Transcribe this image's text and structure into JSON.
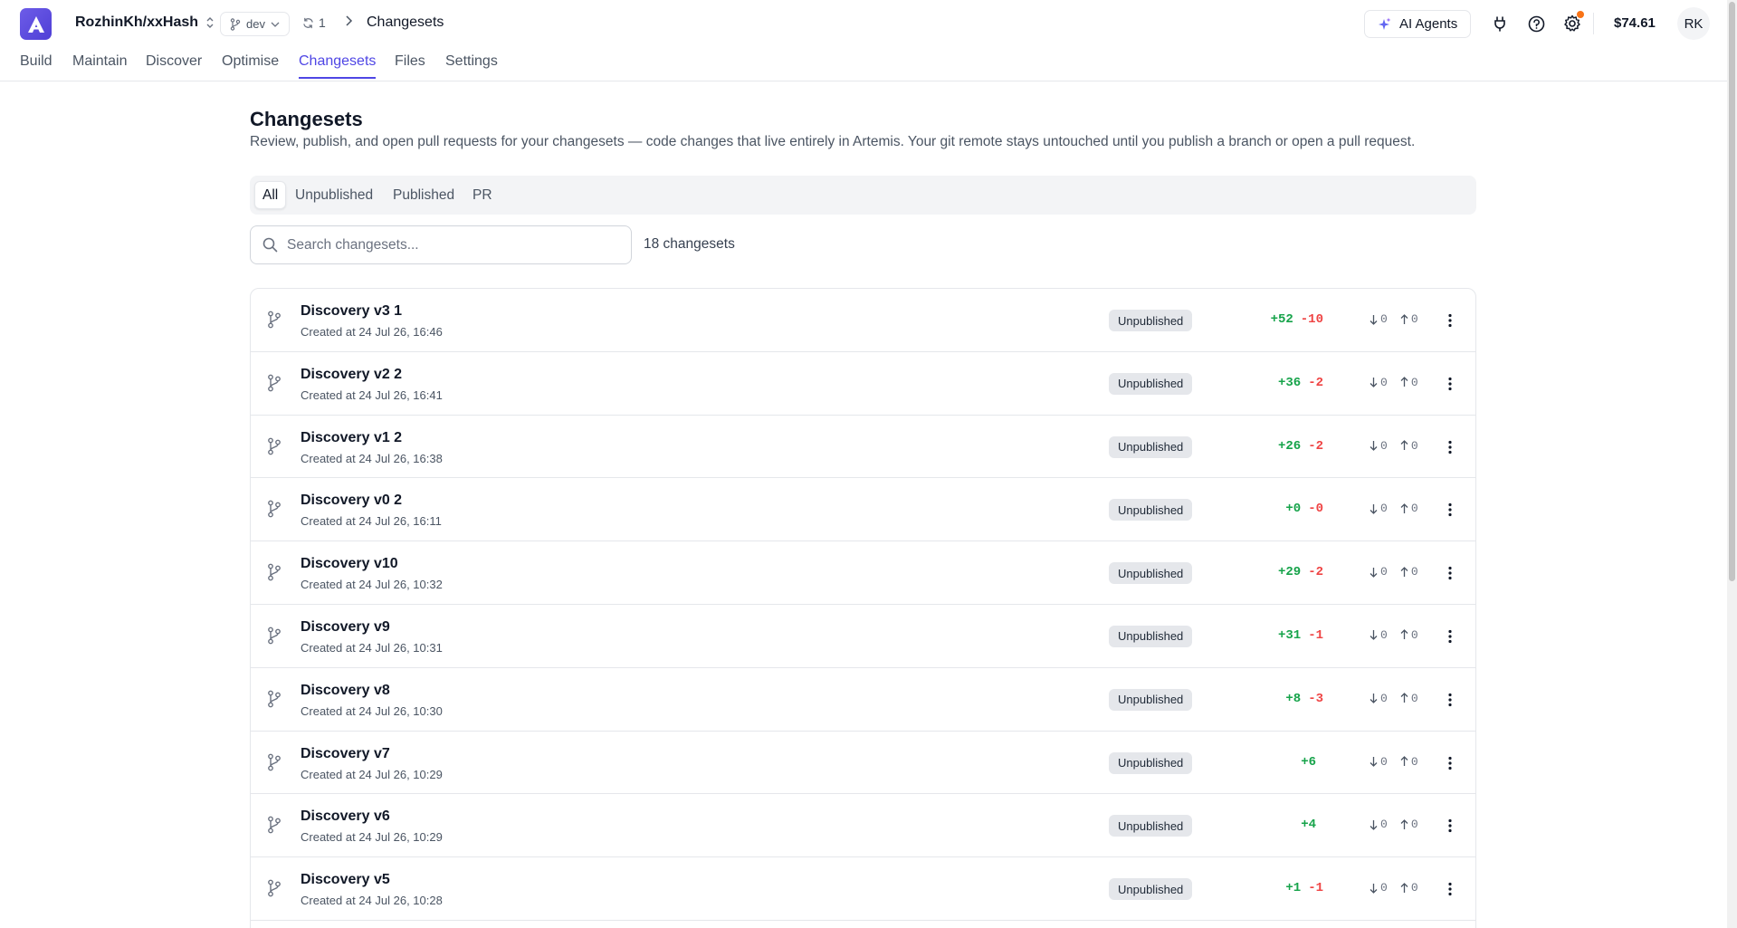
{
  "header": {
    "repo": "RozhinKh/xxHash",
    "branch": "dev",
    "sync_count": "1",
    "breadcrumb": "Changesets",
    "ai_agents_label": "AI Agents",
    "balance": "$74.61",
    "avatar_initials": "RK"
  },
  "nav": {
    "tabs": [
      "Build",
      "Maintain",
      "Discover",
      "Optimise",
      "Changesets",
      "Files",
      "Settings"
    ],
    "active": "Changesets"
  },
  "main": {
    "title": "Changesets",
    "description": "Review, publish, and open pull requests for your changesets — code changes that live entirely in Artemis. Your git remote stays untouched until you publish a branch or open a pull request.",
    "filters": [
      "All",
      "Unpublished",
      "Published",
      "PR"
    ],
    "active_filter": "All",
    "search_placeholder": "Search changesets...",
    "count_label": "18 changesets"
  },
  "changesets": [
    {
      "name": "Discovery v3 1",
      "created": "Created at 24 Jul 26, 16:46",
      "status": "Unpublished",
      "added": "+52",
      "removed": "-10",
      "behind": "0",
      "ahead": "0"
    },
    {
      "name": "Discovery v2 2",
      "created": "Created at 24 Jul 26, 16:41",
      "status": "Unpublished",
      "added": "+36",
      "removed": "-2",
      "behind": "0",
      "ahead": "0"
    },
    {
      "name": "Discovery v1 2",
      "created": "Created at 24 Jul 26, 16:38",
      "status": "Unpublished",
      "added": "+26",
      "removed": "-2",
      "behind": "0",
      "ahead": "0"
    },
    {
      "name": "Discovery v0 2",
      "created": "Created at 24 Jul 26, 16:11",
      "status": "Unpublished",
      "added": "+0",
      "removed": "-0",
      "behind": "0",
      "ahead": "0"
    },
    {
      "name": "Discovery v10",
      "created": "Created at 24 Jul 26, 10:32",
      "status": "Unpublished",
      "added": "+29",
      "removed": "-2",
      "behind": "0",
      "ahead": "0"
    },
    {
      "name": "Discovery v9",
      "created": "Created at 24 Jul 26, 10:31",
      "status": "Unpublished",
      "added": "+31",
      "removed": "-1",
      "behind": "0",
      "ahead": "0"
    },
    {
      "name": "Discovery v8",
      "created": "Created at 24 Jul 26, 10:30",
      "status": "Unpublished",
      "added": "+8",
      "removed": "-3",
      "behind": "0",
      "ahead": "0"
    },
    {
      "name": "Discovery v7",
      "created": "Created at 24 Jul 26, 10:29",
      "status": "Unpublished",
      "added": "+6",
      "removed": "",
      "behind": "0",
      "ahead": "0"
    },
    {
      "name": "Discovery v6",
      "created": "Created at 24 Jul 26, 10:29",
      "status": "Unpublished",
      "added": "+4",
      "removed": "",
      "behind": "0",
      "ahead": "0"
    },
    {
      "name": "Discovery v5",
      "created": "Created at 24 Jul 26, 10:28",
      "status": "Unpublished",
      "added": "+1",
      "removed": "-1",
      "behind": "0",
      "ahead": "0"
    }
  ],
  "colors": {
    "accent": "#4f46e5",
    "added": "#16a34a",
    "removed": "#ef4444",
    "notification_dot": "#f97316"
  }
}
